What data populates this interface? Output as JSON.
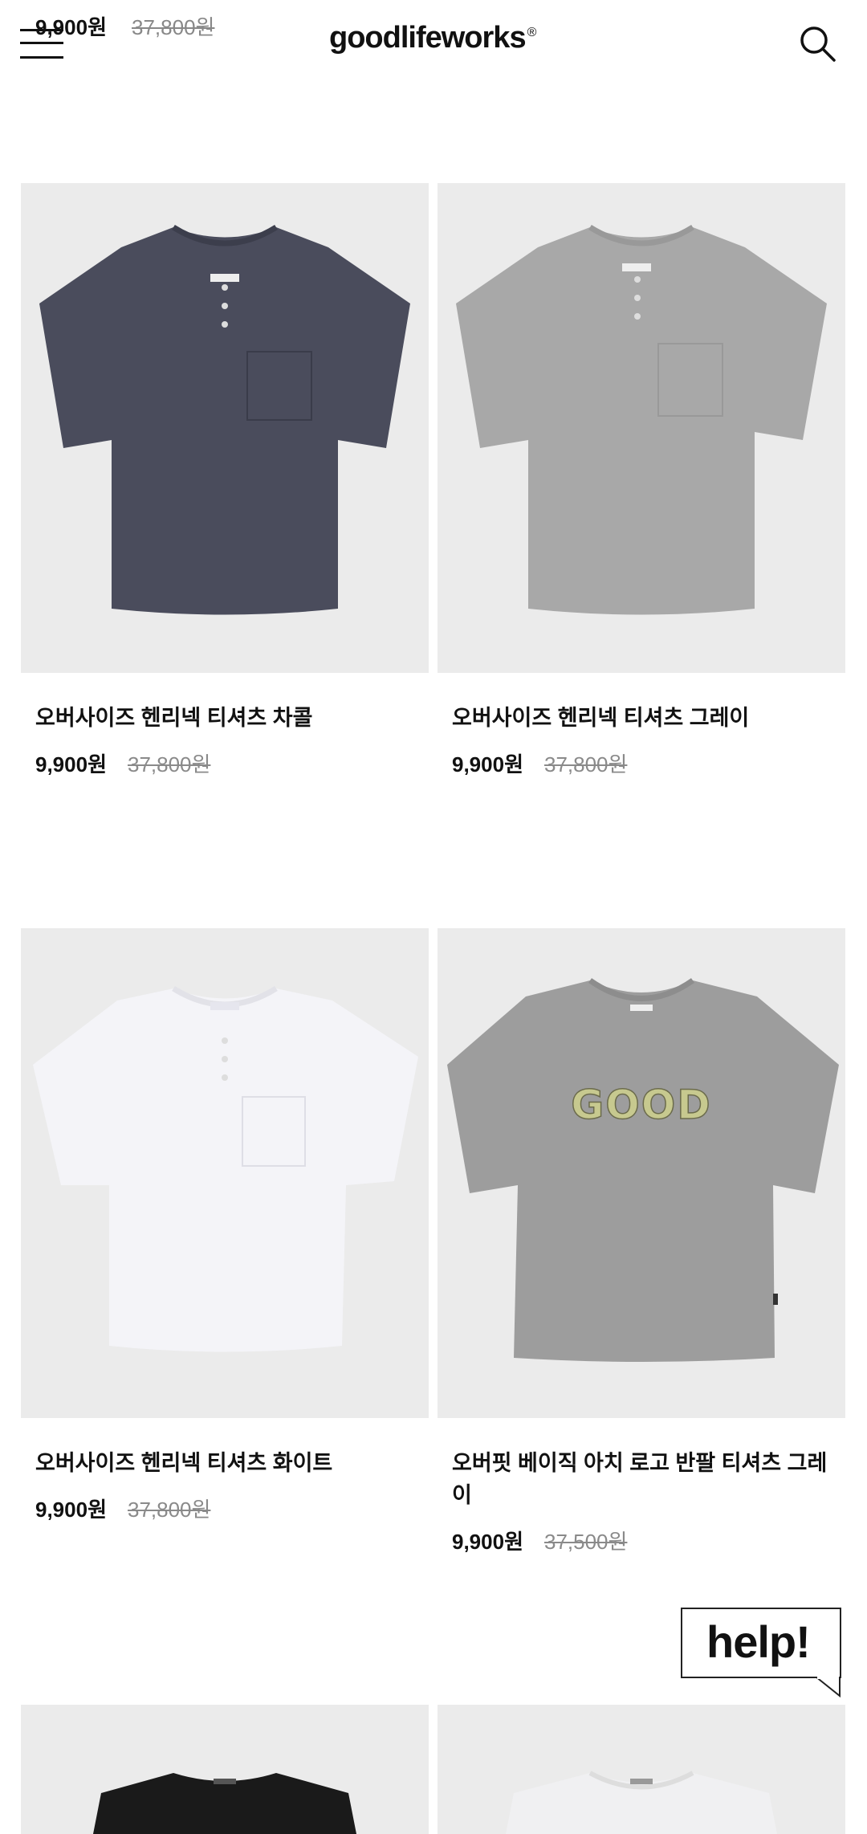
{
  "header": {
    "logo_text": "goodlifeworks",
    "logo_mark": "®",
    "menu_icon": "hamburger-menu-icon",
    "search_icon": "search-icon"
  },
  "previous_row": {
    "left_price": "9,900원",
    "left_original": "37,800원"
  },
  "products": [
    {
      "name": "오버사이즈 헨리넥 티셔츠 차콜",
      "price": "9,900원",
      "original_price": "37,800원",
      "shirt_color": "#4a4c5c",
      "style": "henley"
    },
    {
      "name": "오버사이즈 헨리넥 티셔츠 그레이",
      "price": "9,900원",
      "original_price": "37,800원",
      "shirt_color": "#a8a8a8",
      "style": "henley"
    },
    {
      "name": "오버사이즈 헨리넥 티셔츠 화이트",
      "price": "9,900원",
      "original_price": "37,800원",
      "shirt_color": "#f4f4f8",
      "style": "henley"
    },
    {
      "name": "오버핏 베이직 아치 로고 반팔 티셔츠 그레이",
      "price": "9,900원",
      "original_price": "37,500원",
      "shirt_color": "#9d9d9d",
      "style": "logo",
      "logo_text": "GOOD"
    },
    {
      "name": "",
      "price": "",
      "original_price": "",
      "shirt_color": "#1a1a1a",
      "style": "plain"
    },
    {
      "name": "",
      "price": "",
      "original_price": "",
      "shirt_color": "#f0f0f2",
      "style": "plain"
    }
  ],
  "help_button": {
    "label": "help!"
  }
}
